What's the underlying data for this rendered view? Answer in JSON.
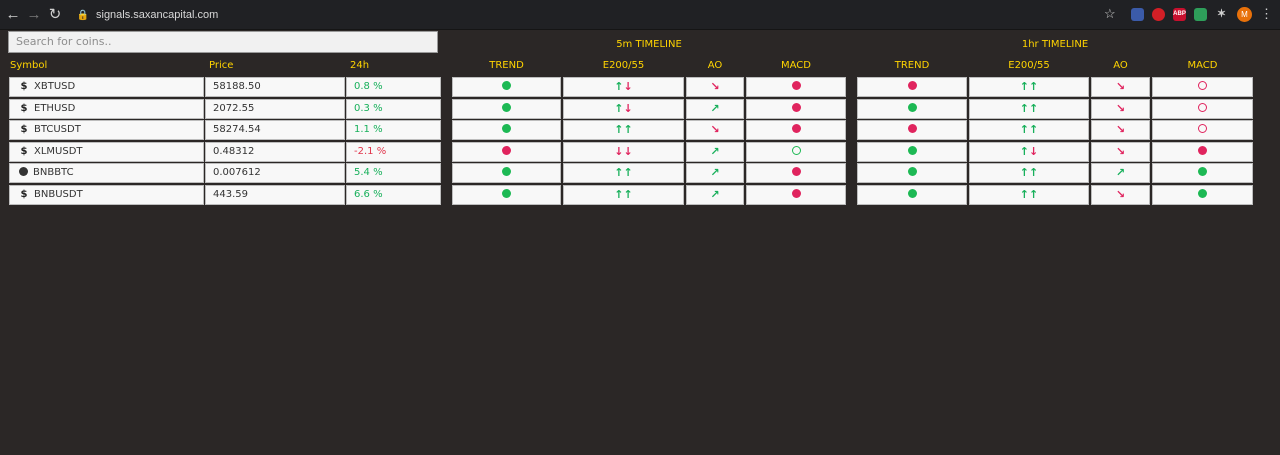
{
  "browser": {
    "url": "signals.saxancapital.com",
    "avatar_letter": "M",
    "ext_abp": "ABP"
  },
  "search": {
    "placeholder": "Search for coins.."
  },
  "headers": {
    "symbol": "Symbol",
    "price": "Price",
    "change": "24h",
    "timeline_5m": "5m TIMELINE",
    "timeline_1hr": "1hr TIMELINE",
    "trend": "TREND",
    "ema": "E200/55",
    "ao": "AO",
    "macd": "MACD"
  },
  "rows": [
    {
      "symbol": "XBTUSD",
      "icon": "dollar-icon",
      "price": "58188.50",
      "change": "0.8 %",
      "change_dir": "up",
      "m5": {
        "trend": "up",
        "ema": [
          "up",
          "down"
        ],
        "ao": "down-right",
        "macd": "red"
      },
      "h1": {
        "trend": "down",
        "ema": [
          "up",
          "up"
        ],
        "ao": "down-right",
        "macd": "ring-red"
      }
    },
    {
      "symbol": "ETHUSD",
      "icon": "dollar-icon",
      "price": "2072.55",
      "change": "0.3 %",
      "change_dir": "up",
      "m5": {
        "trend": "up",
        "ema": [
          "up",
          "down"
        ],
        "ao": "up-right",
        "macd": "red"
      },
      "h1": {
        "trend": "up",
        "ema": [
          "up",
          "up"
        ],
        "ao": "down-right",
        "macd": "ring-red"
      }
    },
    {
      "symbol": "BTCUSDT",
      "icon": "dollar-icon",
      "price": "58274.54",
      "change": "1.1 %",
      "change_dir": "up",
      "m5": {
        "trend": "up",
        "ema": [
          "up",
          "up"
        ],
        "ao": "down-right",
        "macd": "red"
      },
      "h1": {
        "trend": "down",
        "ema": [
          "up",
          "up"
        ],
        "ao": "down-right",
        "macd": "ring-red"
      }
    },
    {
      "symbol": "XLMUSDT",
      "icon": "dollar-icon",
      "price": "0.48312",
      "change": "-2.1 %",
      "change_dir": "down",
      "m5": {
        "trend": "down",
        "ema": [
          "down",
          "down"
        ],
        "ao": "up-right",
        "macd": "ring-green"
      },
      "h1": {
        "trend": "up",
        "ema": [
          "up",
          "down"
        ],
        "ao": "down-right",
        "macd": "red"
      }
    },
    {
      "symbol": "BNBBTC",
      "icon": "bnb-icon",
      "price": "0.007612",
      "change": "5.4 %",
      "change_dir": "up",
      "m5": {
        "trend": "up",
        "ema": [
          "up",
          "up"
        ],
        "ao": "up-right",
        "macd": "red"
      },
      "h1": {
        "trend": "up",
        "ema": [
          "up",
          "up"
        ],
        "ao": "up-right",
        "macd": "green"
      }
    },
    {
      "symbol": "BNBUSDT",
      "icon": "dollar-icon",
      "price": "443.59",
      "change": "6.6 %",
      "change_dir": "up",
      "m5": {
        "trend": "up",
        "ema": [
          "up",
          "up"
        ],
        "ao": "up-right",
        "macd": "red"
      },
      "h1": {
        "trend": "up",
        "ema": [
          "up",
          "up"
        ],
        "ao": "down-right",
        "macd": "green"
      }
    }
  ],
  "colors": {
    "background": "#2b2726",
    "accent": "#ffd400",
    "positive": "#18b05b",
    "negative": "#e0245e"
  }
}
